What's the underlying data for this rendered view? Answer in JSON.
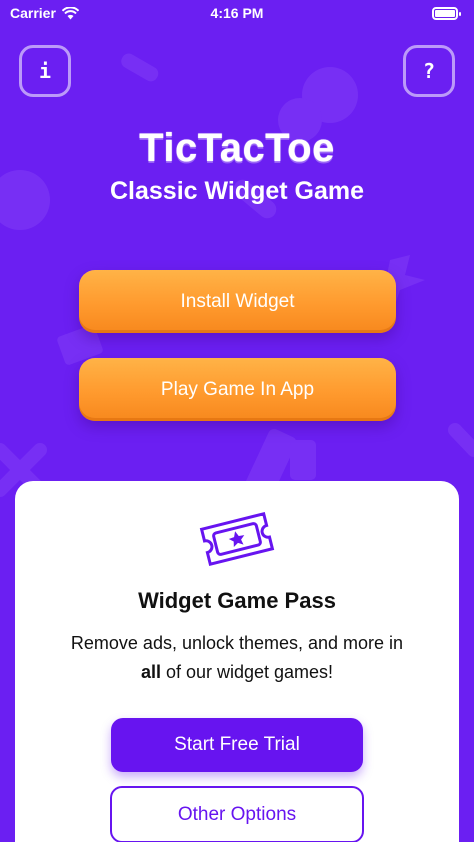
{
  "status_bar": {
    "carrier": "Carrier",
    "time": "4:16 PM"
  },
  "header": {
    "info_label": "i",
    "help_label": "?",
    "title": "TicTacToe",
    "subtitle": "Classic Widget Game"
  },
  "actions": {
    "install_label": "Install Widget",
    "play_label": "Play Game In App"
  },
  "pass_card": {
    "title": "Widget Game Pass",
    "desc_part1": "Remove ads, unlock themes, and more in",
    "desc_bold": "all",
    "desc_part2": " of our widget games!",
    "trial_label": "Start Free Trial",
    "other_label": "Other Options"
  },
  "colors": {
    "background": "#6b1ff2",
    "accent_orange": "#ff9a2e",
    "accent_purple": "#6714f0"
  }
}
